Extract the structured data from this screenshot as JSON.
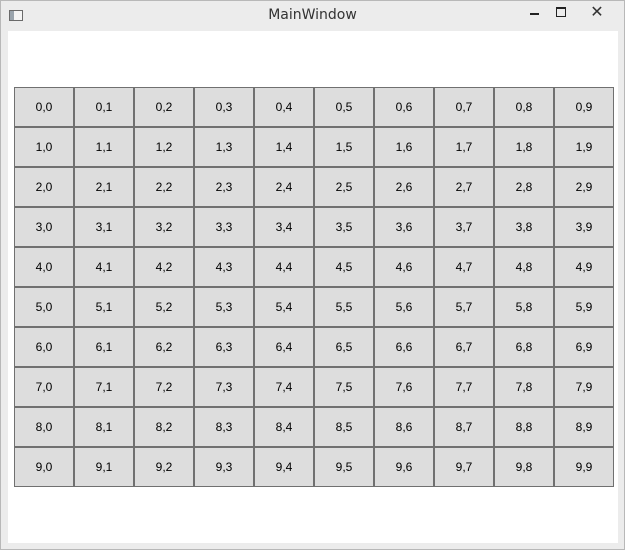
{
  "window": {
    "title": "MainWindow",
    "controls": {
      "minimize": "minimize",
      "maximize": "maximize",
      "close": "✕"
    }
  },
  "grid": {
    "rows": 10,
    "cols": 10,
    "cells": [
      [
        "0,0",
        "0,1",
        "0,2",
        "0,3",
        "0,4",
        "0,5",
        "0,6",
        "0,7",
        "0,8",
        "0,9"
      ],
      [
        "1,0",
        "1,1",
        "1,2",
        "1,3",
        "1,4",
        "1,5",
        "1,6",
        "1,7",
        "1,8",
        "1,9"
      ],
      [
        "2,0",
        "2,1",
        "2,2",
        "2,3",
        "2,4",
        "2,5",
        "2,6",
        "2,7",
        "2,8",
        "2,9"
      ],
      [
        "3,0",
        "3,1",
        "3,2",
        "3,3",
        "3,4",
        "3,5",
        "3,6",
        "3,7",
        "3,8",
        "3,9"
      ],
      [
        "4,0",
        "4,1",
        "4,2",
        "4,3",
        "4,4",
        "4,5",
        "4,6",
        "4,7",
        "4,8",
        "4,9"
      ],
      [
        "5,0",
        "5,1",
        "5,2",
        "5,3",
        "5,4",
        "5,5",
        "5,6",
        "5,7",
        "5,8",
        "5,9"
      ],
      [
        "6,0",
        "6,1",
        "6,2",
        "6,3",
        "6,4",
        "6,5",
        "6,6",
        "6,7",
        "6,8",
        "6,9"
      ],
      [
        "7,0",
        "7,1",
        "7,2",
        "7,3",
        "7,4",
        "7,5",
        "7,6",
        "7,7",
        "7,8",
        "7,9"
      ],
      [
        "8,0",
        "8,1",
        "8,2",
        "8,3",
        "8,4",
        "8,5",
        "8,6",
        "8,7",
        "8,8",
        "8,9"
      ],
      [
        "9,0",
        "9,1",
        "9,2",
        "9,3",
        "9,4",
        "9,5",
        "9,6",
        "9,7",
        "9,8",
        "9,9"
      ]
    ]
  },
  "colors": {
    "cell_background": "#dddddd",
    "cell_border": "#707070",
    "titlebar": "#ececec",
    "client": "#ffffff"
  }
}
